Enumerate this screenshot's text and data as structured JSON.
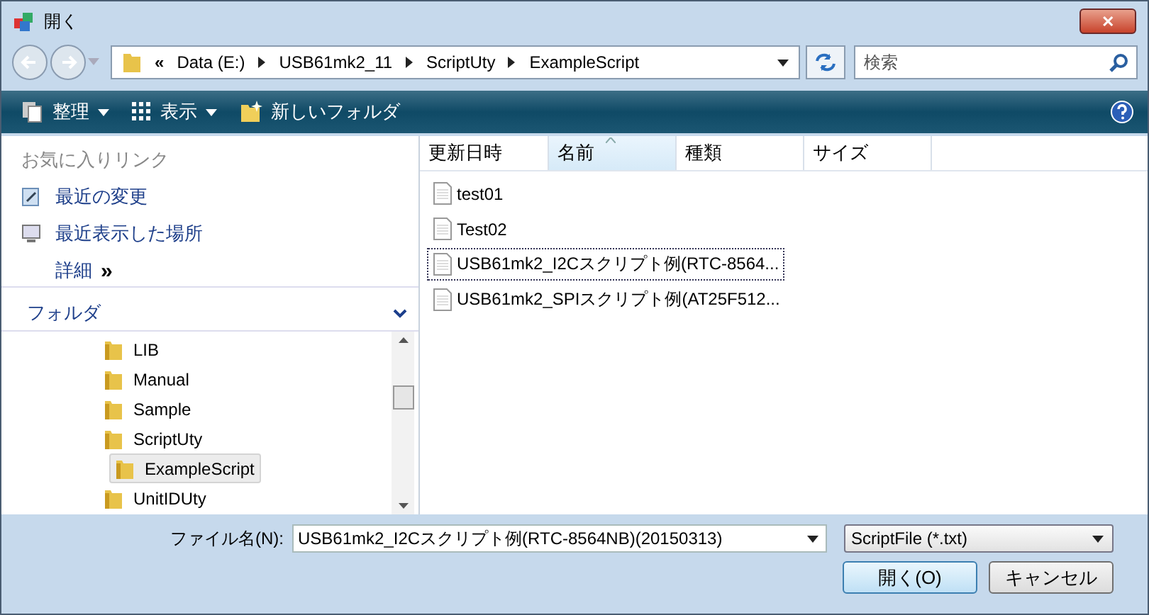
{
  "window": {
    "title": "開く",
    "close": "✕"
  },
  "address": {
    "prefix": "«",
    "crumbs": [
      "Data (E:)",
      "USB61mk2_11",
      "ScriptUty",
      "ExampleScript"
    ]
  },
  "search": {
    "placeholder": "検索"
  },
  "toolbar": {
    "items": [
      {
        "label": "整理",
        "kind": "menu"
      },
      {
        "label": "表示",
        "kind": "menu"
      },
      {
        "label": "新しいフォルダ",
        "kind": "plain"
      }
    ]
  },
  "favorites": {
    "title": "お気に入りリンク",
    "links": [
      {
        "label": "最近の変更",
        "kind": "recent"
      },
      {
        "label": "最近表示した場所",
        "kind": "places"
      }
    ],
    "more": {
      "label": "詳細",
      "chevron": "»"
    }
  },
  "folders": {
    "title": "フォルダ",
    "tree": [
      {
        "label": "LIB",
        "selected": false
      },
      {
        "label": "Manual",
        "selected": false
      },
      {
        "label": "Sample",
        "selected": false
      },
      {
        "label": "ScriptUty",
        "selected": false,
        "children": [
          {
            "label": "ExampleScript",
            "selected": true
          }
        ]
      },
      {
        "label": "UnitIDUty",
        "selected": false
      }
    ]
  },
  "columns": [
    {
      "label": "更新日時",
      "sorted": false
    },
    {
      "label": "名前",
      "sorted": true
    },
    {
      "label": "種類",
      "sorted": false
    },
    {
      "label": "サイズ",
      "sorted": false
    }
  ],
  "files": [
    {
      "name": "test01",
      "selected": false
    },
    {
      "name": "Test02",
      "selected": false
    },
    {
      "name": "USB61mk2_I2Cスクリプト例(RTC-8564...",
      "selected": true
    },
    {
      "name": "USB61mk2_SPIスクリプト例(AT25F512...",
      "selected": false
    }
  ],
  "filename": {
    "label": "ファイル名(N):",
    "value": "USB61mk2_I2Cスクリプト例(RTC-8564NB)(20150313)"
  },
  "filetype": {
    "value": "ScriptFile (*.txt)"
  },
  "buttons": [
    {
      "label": "開く(O)",
      "kind": "default"
    },
    {
      "label": "キャンセル",
      "kind": "normal"
    }
  ]
}
